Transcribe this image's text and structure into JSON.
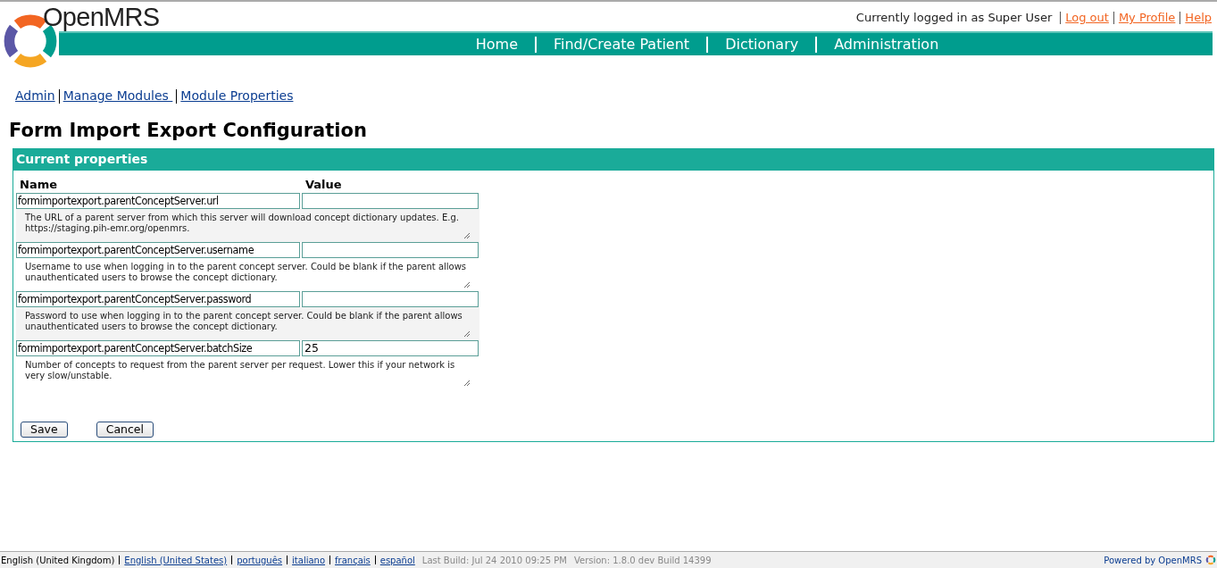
{
  "header": {
    "logo_text": "OpenMRS",
    "user_text": "Currently logged in as Super User",
    "user_links": [
      "Log out",
      "My Profile",
      "Help"
    ],
    "nav": [
      "Home",
      "Find/Create Patient",
      "Dictionary",
      "Administration"
    ]
  },
  "breadcrumbs": [
    "Admin",
    "Manage Modules ",
    "Module Properties"
  ],
  "title": "Form Import Export Configuration",
  "panel": {
    "title": "Current properties",
    "columns": [
      "Name",
      "Value"
    ],
    "properties": [
      {
        "name": "formimportexport.parentConceptServer.url",
        "description": "The URL of a parent server from which this server will download concept dictionary updates. E.g. https://staging.pih-emr.org/openmrs."
      },
      {
        "name": "formimportexport.parentConceptServer.username",
        "description": "Username to use when logging in to the parent concept server. Could be blank if the parent allows unauthenticated users to browse the concept dictionary."
      },
      {
        "name": "formimportexport.parentConceptServer.password",
        "description": "Password to use when logging in to the parent concept server. Could be blank if the parent allows unauthenticated users to browse the concept dictionary."
      },
      {
        "name": "formimportexport.parentConceptServer.batchSize",
        "value": "25",
        "description": "Number of concepts to request from the parent server per request. Lower this if your network is very slow/unstable."
      }
    ],
    "buttons": [
      "Save",
      "Cancel"
    ]
  },
  "footer": {
    "current_language": "English (United Kingdom)",
    "languages": [
      "English (United States)",
      "português",
      "italiano",
      "français",
      "español"
    ],
    "build": "Last Build: Jul 24 2010 09:25 PM",
    "version": "Version: 1.8.0 dev Build 14399",
    "powered": "Powered by OpenMRS"
  }
}
